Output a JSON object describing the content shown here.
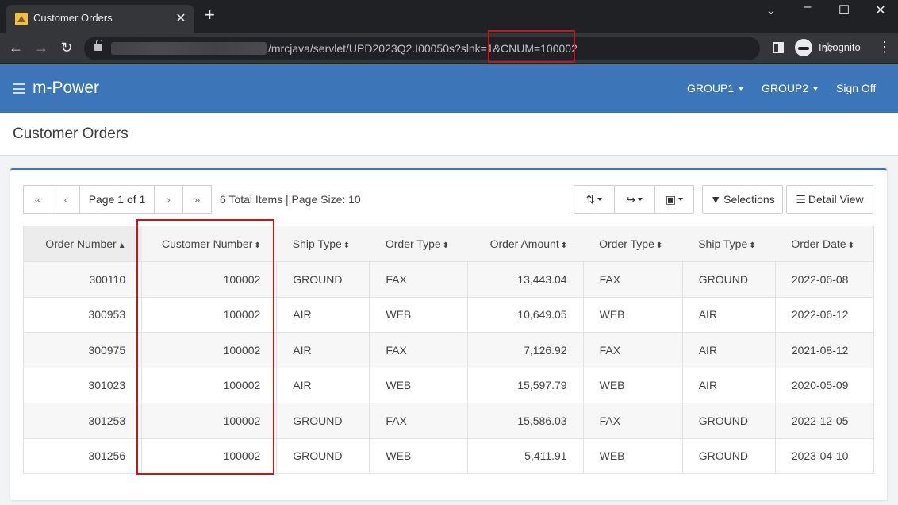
{
  "browser": {
    "tab_title": "Customer Orders",
    "url_visible": "/mrcjava/servlet/UPD2023Q2.I00050s?slnk=1&CNUM=100002",
    "incognito_label": "Incognito"
  },
  "app": {
    "brand": "m-Power",
    "nav": [
      {
        "label": "GROUP1",
        "dropdown": true
      },
      {
        "label": "GROUP2",
        "dropdown": true
      },
      {
        "label": "Sign Off",
        "dropdown": false
      }
    ]
  },
  "page": {
    "title": "Customer Orders"
  },
  "pager": {
    "first": "«",
    "prev": "‹",
    "page_label": "Page 1 of 1",
    "next": "›",
    "last": "»",
    "summary": "6 Total Items | Page Size: 10"
  },
  "toolbar": {
    "sort_icon": "sort-amount-icon",
    "share_icon": "share-icon",
    "save_icon": "floppy-disk-icon",
    "selections_label": "Selections",
    "detail_view_label": "Detail View"
  },
  "table": {
    "columns": [
      {
        "label": "Order Number",
        "sort": "▲",
        "align": "num"
      },
      {
        "label": "Customer Number",
        "sort": "⬍",
        "align": "num"
      },
      {
        "label": "Ship Type",
        "sort": "⬍",
        "align": "txt"
      },
      {
        "label": "Order Type",
        "sort": "⬍",
        "align": "txt"
      },
      {
        "label": "Order Amount",
        "sort": "⬍",
        "align": "num"
      },
      {
        "label": "Order Type",
        "sort": "⬍",
        "align": "txt"
      },
      {
        "label": "Ship Type",
        "sort": "⬍",
        "align": "txt"
      },
      {
        "label": "Order Date",
        "sort": "⬍",
        "align": "txt"
      }
    ],
    "rows": [
      [
        "300110",
        "100002",
        "GROUND",
        "FAX",
        "13,443.04",
        "FAX",
        "GROUND",
        "2022-06-08"
      ],
      [
        "300953",
        "100002",
        "AIR",
        "WEB",
        "10,649.05",
        "WEB",
        "AIR",
        "2022-06-12"
      ],
      [
        "300975",
        "100002",
        "AIR",
        "FAX",
        "7,126.92",
        "FAX",
        "AIR",
        "2021-08-12"
      ],
      [
        "301023",
        "100002",
        "AIR",
        "WEB",
        "15,597.79",
        "WEB",
        "AIR",
        "2020-05-09"
      ],
      [
        "301253",
        "100002",
        "GROUND",
        "FAX",
        "15,586.03",
        "FAX",
        "GROUND",
        "2022-12-05"
      ],
      [
        "301256",
        "100002",
        "GROUND",
        "WEB",
        "5,411.91",
        "WEB",
        "GROUND",
        "2023-04-10"
      ]
    ]
  },
  "colors": {
    "app_bar": "#3d76b8",
    "highlight_box": "#c0181c"
  }
}
